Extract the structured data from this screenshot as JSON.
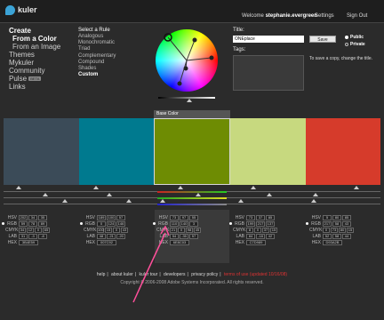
{
  "header": {
    "brand": "kuler",
    "welcome_prefix": "Welcome",
    "username": "stephanie.evergreen",
    "settings": "Settings",
    "sign_out": "Sign Out"
  },
  "nav": {
    "create": "Create",
    "from_color": "From a Color",
    "from_image": "From an Image",
    "themes": "Themes",
    "mykuler": "Mykuler",
    "community": "Community",
    "pulse": "Pulse",
    "pulse_badge": "BETA",
    "links": "Links"
  },
  "rules": {
    "heading": "Select a Rule",
    "options": [
      "Analogous",
      "Monochromatic",
      "Triad",
      "Complementary",
      "Compound",
      "Shades",
      "Custom"
    ],
    "selected": "Custom"
  },
  "form": {
    "title_label": "Title:",
    "title_value": "ONEplace",
    "save_label": "Save",
    "tags_label": "Tags:",
    "public_label": "Public",
    "private_label": "Private",
    "note": "To save a copy, change the title."
  },
  "base_color_label": "Base Color",
  "colors": {
    "c1": "#3b4b58",
    "c2": "#007a8f",
    "c3": "#6e8c03",
    "c4": "#c7d97f",
    "c5": "#d63b2b"
  },
  "swatches": [
    {
      "hsv": [
        "202",
        "34",
        "35"
      ],
      "rgb": [
        "59",
        "78",
        "89"
      ],
      "cmyk": [
        "34",
        "12",
        "0",
        "65"
      ],
      "lab": [
        "31",
        "-3",
        "-8"
      ],
      "hex": "3B4E59"
    },
    {
      "hsv": [
        "189",
        "100",
        "57"
      ],
      "rgb": [
        "0",
        "124",
        "146"
      ],
      "cmyk": [
        "100",
        "15",
        "0",
        "43"
      ],
      "lab": [
        "48",
        "-21",
        "-20"
      ],
      "hex": "007C92"
    },
    {
      "hsv": [
        "73",
        "97",
        "55"
      ],
      "rgb": [
        "110",
        "140",
        "3"
      ],
      "cmyk": [
        "21",
        "0",
        "98",
        "45"
      ],
      "lab": [
        "54",
        "-35",
        "57"
      ],
      "hex": "6E8C03"
    },
    {
      "hsv": [
        "73",
        "37",
        "85"
      ],
      "rgb": [
        "199",
        "217",
        "137"
      ],
      "cmyk": [
        "8",
        "0",
        "37",
        "15"
      ],
      "lab": [
        "84",
        "-18",
        "42"
      ],
      "hex": "C7D989"
    },
    {
      "hsv": [
        "5",
        "80",
        "85"
      ],
      "rgb": [
        "217",
        "58",
        "43"
      ],
      "cmyk": [
        "0",
        "73",
        "80",
        "15"
      ],
      "lab": [
        "52",
        "58",
        "44"
      ],
      "hex": "D93A2B"
    }
  ],
  "labels": {
    "hsv": "HSV",
    "rgb": "RGB",
    "cmyk": "CMYK",
    "lab": "LAB",
    "hex": "HEX"
  },
  "footer": {
    "help": "help",
    "about": "about kuler",
    "tour": "kuler tour",
    "developers": "developers",
    "privacy": "privacy policy",
    "terms": "terms of use (updated 10/16/08)",
    "copyright": "Copyright © 2006-2008 Adobe Systems Incorporated. All rights reserved."
  }
}
